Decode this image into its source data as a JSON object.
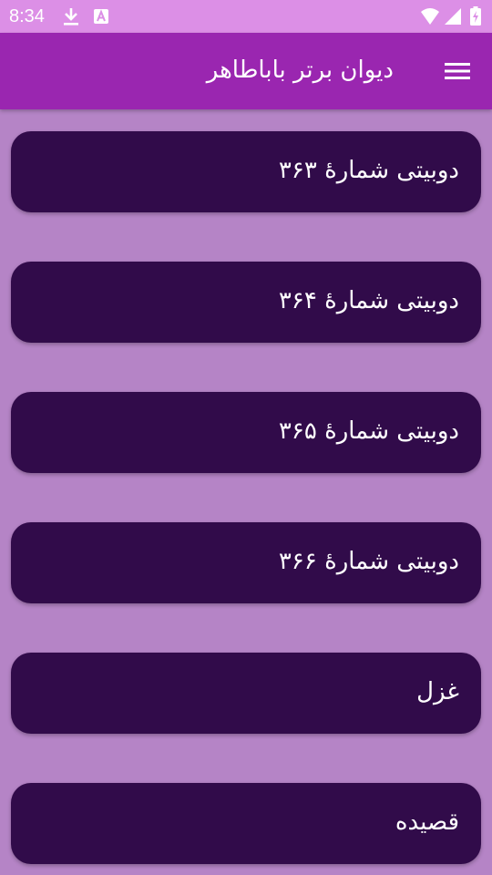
{
  "status_bar": {
    "time": "8:34",
    "icons": [
      "download-icon",
      "text-a-icon",
      "wifi-icon",
      "cell-signal-icon",
      "battery-charging-icon"
    ]
  },
  "app_bar": {
    "title": "دیوان برتر باباطاهر",
    "menu_icon": "hamburger-menu-icon"
  },
  "list": {
    "items": [
      {
        "label": "دوبیتی شمارهٔ ۳۶۳"
      },
      {
        "label": "دوبیتی شمارهٔ ۳۶۴"
      },
      {
        "label": "دوبیتی شمارهٔ ۳۶۵"
      },
      {
        "label": "دوبیتی شمارهٔ ۳۶۶"
      },
      {
        "label": "غزل"
      },
      {
        "label": "قصیده"
      }
    ]
  },
  "colors": {
    "status_bar": "#dc8fe6",
    "app_bar": "#9a26b0",
    "background": "#b584c6",
    "card": "#310b4a",
    "text": "#ffffff"
  }
}
